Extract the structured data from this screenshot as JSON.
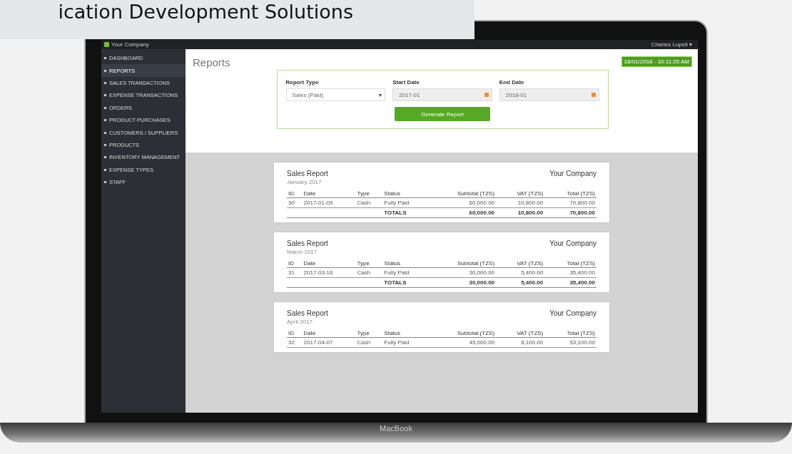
{
  "caption": "ication Development Solutions",
  "topbar": {
    "brand": "Your Company",
    "user": "Charles Lupeli ▾"
  },
  "sidebar": {
    "items": [
      {
        "label": "DASHBOARD",
        "selected": false
      },
      {
        "label": "REPORTS",
        "selected": true
      },
      {
        "label": "SALES TRANSACTIONS",
        "selected": false
      },
      {
        "label": "EXPENSE TRANSACTIONS",
        "selected": false
      },
      {
        "label": "ORDERS",
        "selected": false
      },
      {
        "label": "PRODUCT PURCHASES",
        "selected": false
      },
      {
        "label": "CUSTOMERS / SUPPLIERS",
        "selected": false
      },
      {
        "label": "PRODUCTS",
        "selected": false
      },
      {
        "label": "INVENTORY MANAGEMENT",
        "selected": false
      },
      {
        "label": "EXPENSE TYPES",
        "selected": false
      },
      {
        "label": "STAFF",
        "selected": false
      }
    ]
  },
  "page": {
    "title": "Reports",
    "datetime": "18/01/2018 - 10:11:25 AM"
  },
  "form": {
    "report_type": {
      "label": "Report Type",
      "value": "Sales (Paid)",
      "caret": "▾"
    },
    "start_date": {
      "label": "Start Date",
      "value": "2017-01"
    },
    "end_date": {
      "label": "End Date",
      "value": "2018-01"
    },
    "button": "Generate Report"
  },
  "reports": [
    {
      "title": "Sales Report",
      "company": "Your Company",
      "period": "January 2017",
      "columns": [
        "ID",
        "Date",
        "Type",
        "Status",
        "Subtotal (TZS)",
        "VAT (TZS)",
        "Total (TZS)"
      ],
      "rows": [
        [
          "30",
          "2017-01-09",
          "Cash",
          "Fully Paid",
          "60,000.00",
          "10,800.00",
          "70,800.00"
        ]
      ],
      "totals": {
        "label": "TOTALS",
        "values": [
          "60,000.00",
          "10,800.00",
          "70,800.00"
        ]
      }
    },
    {
      "title": "Sales Report",
      "company": "Your Company",
      "period": "March 2017",
      "columns": [
        "ID",
        "Date",
        "Type",
        "Status",
        "Subtotal (TZS)",
        "VAT (TZS)",
        "Total (TZS)"
      ],
      "rows": [
        [
          "31",
          "2017-03-16",
          "Cash",
          "Fully Paid",
          "30,000.00",
          "5,400.00",
          "35,400.00"
        ]
      ],
      "totals": {
        "label": "TOTALS",
        "values": [
          "30,000.00",
          "5,400.00",
          "35,400.00"
        ]
      }
    },
    {
      "title": "Sales Report",
      "company": "Your Company",
      "period": "April 2017",
      "columns": [
        "ID",
        "Date",
        "Type",
        "Status",
        "Subtotal (TZS)",
        "VAT (TZS)",
        "Total (TZS)"
      ],
      "rows": [
        [
          "32",
          "2017-04-07",
          "Cash",
          "Fully Paid",
          "45,000.00",
          "8,100.00",
          "53,100.00"
        ]
      ]
    }
  ],
  "laptop": {
    "label": "MacBook"
  }
}
